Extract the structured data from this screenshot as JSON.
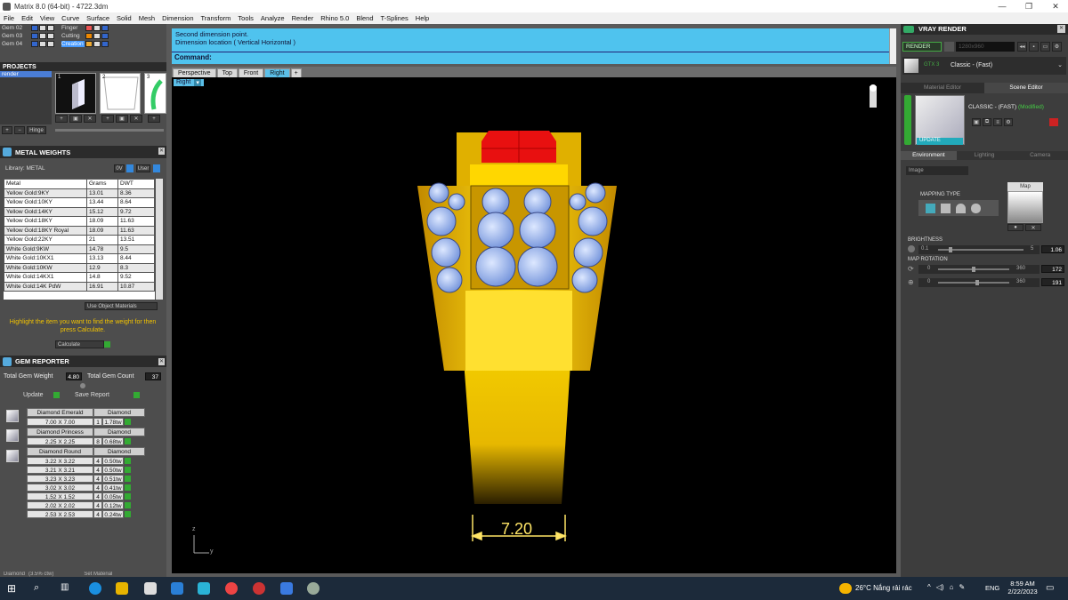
{
  "window": {
    "title": "Matrix 8.0 (64-bit) - 4722.3dm"
  },
  "menu": [
    "File",
    "Edit",
    "View",
    "Curve",
    "Surface",
    "Solid",
    "Mesh",
    "Dimension",
    "Transform",
    "Tools",
    "Analyze",
    "Render",
    "Rhino 5.0",
    "Blend",
    "T-Splines",
    "Help"
  ],
  "gem_layers": [
    {
      "label": "Gem 02",
      "right": "Finger"
    },
    {
      "label": "Gem 03",
      "right": "Cutting"
    },
    {
      "label": "Gem 04",
      "right": "Creation"
    }
  ],
  "projects": {
    "title": "PROJECTS",
    "item": "render",
    "hinge_label": "Hinge",
    "thumb_nums": [
      "1",
      "2",
      "3"
    ]
  },
  "metal_weights": {
    "title": "METAL WEIGHTS",
    "library_label": "Library: METAL",
    "btn_oz": "0V",
    "btn_user": "User",
    "headers": [
      "Metal",
      "Grams",
      "DWT"
    ],
    "rows": [
      [
        "Yellow Gold:9KY",
        "13.01",
        "8.36"
      ],
      [
        "Yellow Gold:10KY",
        "13.44",
        "8.64"
      ],
      [
        "Yellow Gold:14KY",
        "15.12",
        "9.72"
      ],
      [
        "Yellow Gold:18KY",
        "18.09",
        "11.63"
      ],
      [
        "Yellow Gold:18KY Royal",
        "18.09",
        "11.63"
      ],
      [
        "Yellow Gold:22KY",
        "21",
        "13.51"
      ],
      [
        "White Gold:9KW",
        "14.78",
        "9.5"
      ],
      [
        "White Gold:10KX1",
        "13.13",
        "8.44"
      ],
      [
        "White Gold:10KW",
        "12.9",
        "8.3"
      ],
      [
        "White Gold:14KX1",
        "14.8",
        "9.52"
      ],
      [
        "White Gold:14K PdW",
        "16.91",
        "10.87"
      ]
    ],
    "use_object_materials": "Use Object Materials",
    "hint": "Highlight the item you want to find the weight for then press Calculate.",
    "calculate": "Calculate"
  },
  "gem_reporter": {
    "title": "GEM REPORTER",
    "total_weight_label": "Total Gem Weight",
    "total_weight": "4.80",
    "total_count_label": "Total Gem Count",
    "total_count": "37",
    "update": "Update",
    "save_report": "Save Report",
    "groups": [
      {
        "name": "Diamond Emerald",
        "type": "Diamond",
        "rows": [
          [
            "7.00 X 7.00",
            "1",
            "1.78tw"
          ]
        ]
      },
      {
        "name": "Diamond Princess",
        "type": "Diamond",
        "rows": [
          [
            "2.25 X 2.25",
            "8",
            "0.68tw"
          ]
        ]
      },
      {
        "name": "Diamond Round",
        "type": "Diamond",
        "rows": [
          [
            "3.22 X 3.22",
            "4",
            "0.50tw"
          ],
          [
            "3.21 X 3.21",
            "4",
            "0.50tw"
          ],
          [
            "3.23 X 3.23",
            "4",
            "0.51tw"
          ],
          [
            "3.02 X 3.02",
            "4",
            "0.41tw"
          ],
          [
            "1.52 X 1.52",
            "4",
            "0.05tw"
          ],
          [
            "2.02 X 2.02",
            "4",
            "0.12tw"
          ],
          [
            "2.53 X 2.53",
            "4",
            "0.24tw"
          ]
        ]
      }
    ]
  },
  "command": {
    "line1": "Second dimension point.",
    "line2": "Dimension location ( Vertical  Horizontal )",
    "prompt": "Command:"
  },
  "viewport_tabs": [
    "Perspective",
    "Top",
    "Front",
    "Right"
  ],
  "active_view": "Right",
  "dimension_value": "7.20",
  "axis": {
    "z": "z",
    "y": "y"
  },
  "vray": {
    "title": "VRAY RENDER",
    "render_btn": "RENDER",
    "resolution": "1280x960",
    "preset": "Classic - (Fast)",
    "preset_small": "GTX 3",
    "tabs": [
      "Material Editor",
      "Scene Editor"
    ],
    "material_name": "CLASSIC - (FAST)",
    "modified": "(Modified)",
    "update": "UPDATE",
    "env_tabs": [
      "Environment",
      "Lighting",
      "Camera"
    ],
    "env_type": "Image",
    "mapping_type": "MAPPING TYPE",
    "map_label": "Map",
    "brightness_label": "BRIGHTNESS",
    "brightness_min": "0.1",
    "brightness_max": "5",
    "brightness_val": "1.06",
    "rotation_label": "MAP ROTATION",
    "rot1_min": "0",
    "rot1_max": "360",
    "rot1_val": "172",
    "rot2_min": "0",
    "rot2_max": "360",
    "rot2_val": "191"
  },
  "taskbar": {
    "weather": "26°C  Nắng rải rác",
    "lang": "ENG",
    "time": "8:59 AM",
    "date": "2/22/2023"
  },
  "bottom_left": {
    "left": "Diamond",
    "mid": "(3.5% ctw)",
    "right": "Set Material"
  }
}
